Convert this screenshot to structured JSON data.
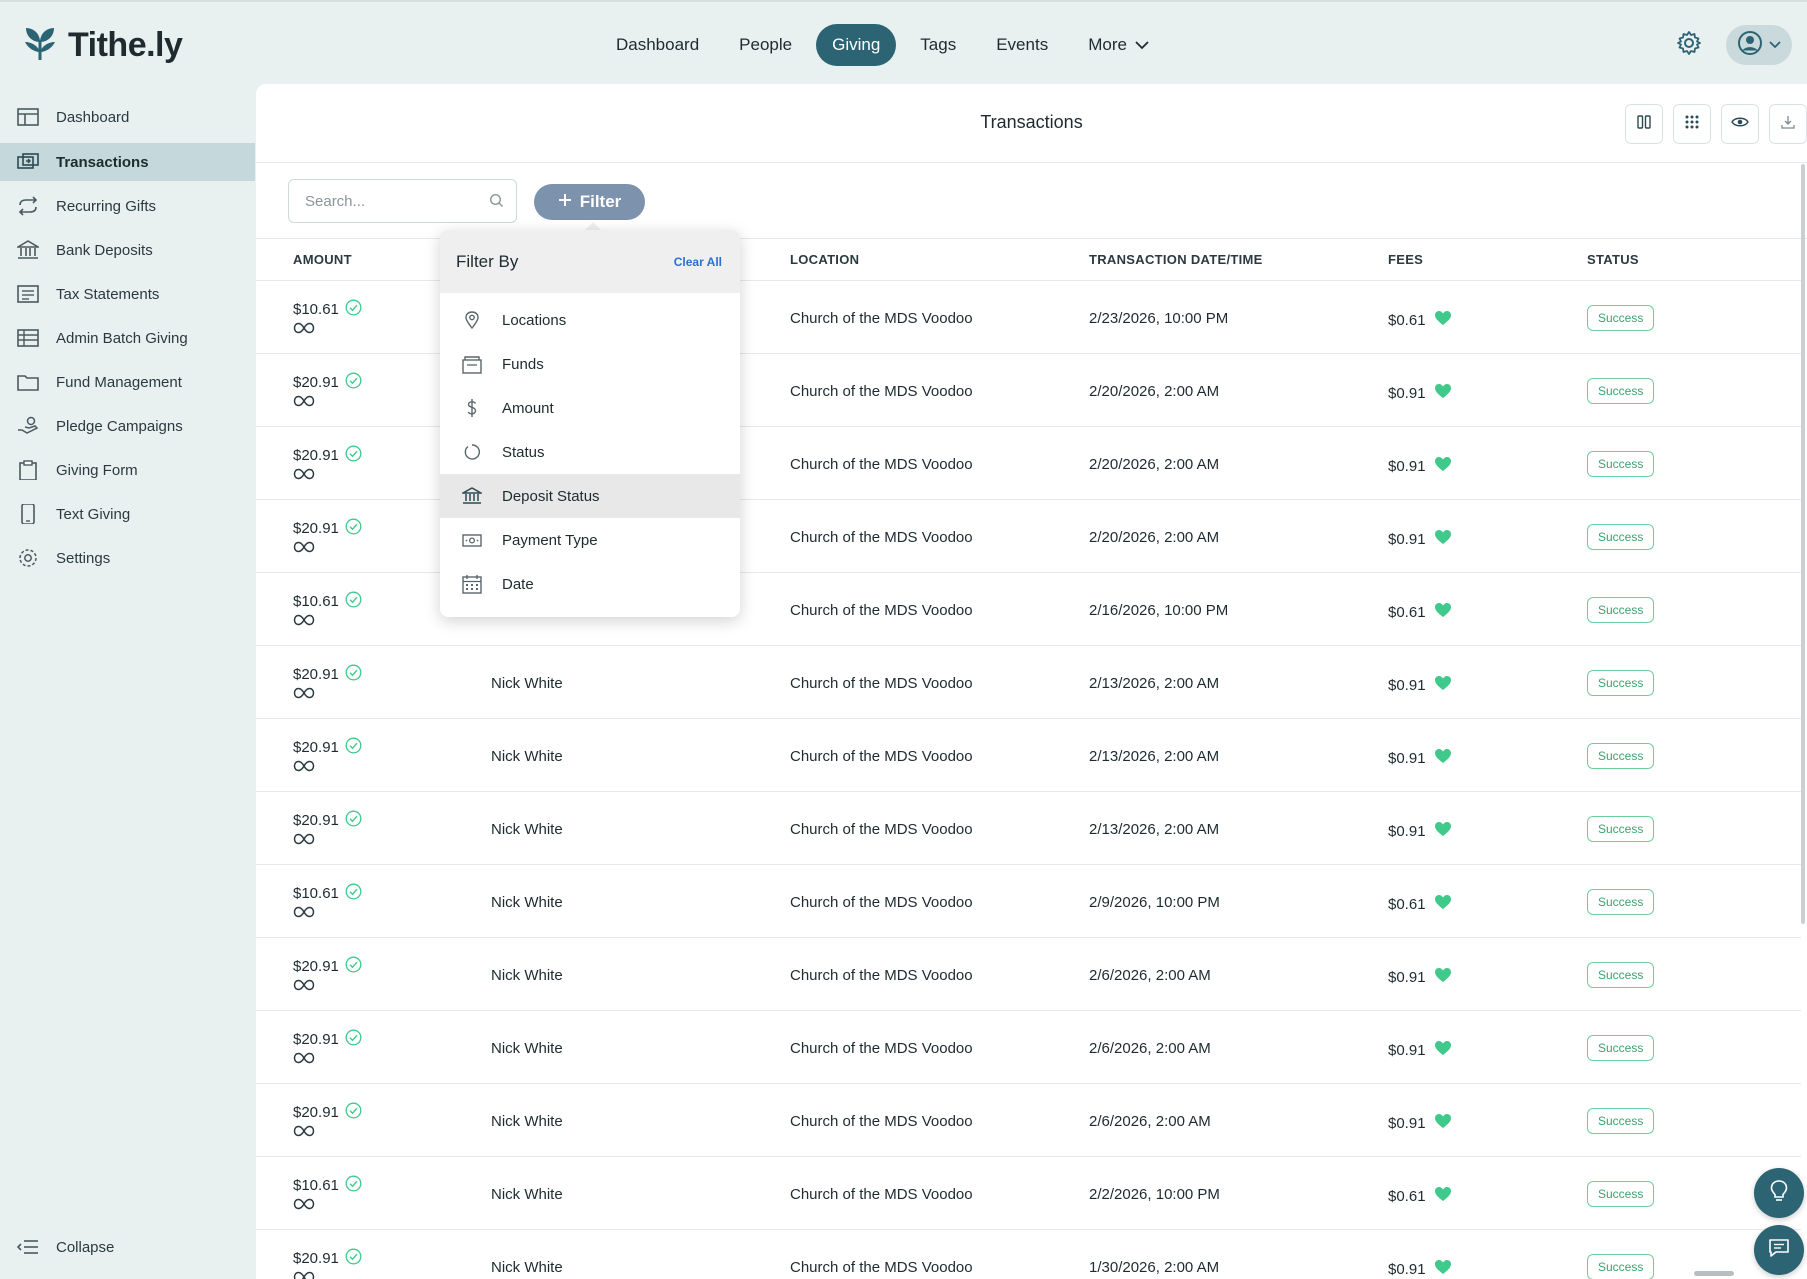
{
  "brand": {
    "name": "Tithe.ly",
    "accent": "#2c6474",
    "success": "#3ba36d",
    "heart": "#3fc98a"
  },
  "nav": {
    "items": [
      {
        "label": "Dashboard",
        "active": false
      },
      {
        "label": "People",
        "active": false
      },
      {
        "label": "Giving",
        "active": true
      },
      {
        "label": "Tags",
        "active": false
      },
      {
        "label": "Events",
        "active": false
      },
      {
        "label": "More",
        "active": false
      }
    ]
  },
  "sidebar": {
    "items": [
      {
        "label": "Dashboard",
        "icon": "dashboard-icon"
      },
      {
        "label": "Transactions",
        "icon": "transactions-icon",
        "active": true
      },
      {
        "label": "Recurring Gifts",
        "icon": "recurring-icon"
      },
      {
        "label": "Bank Deposits",
        "icon": "bank-icon"
      },
      {
        "label": "Tax Statements",
        "icon": "statement-icon"
      },
      {
        "label": "Admin Batch Giving",
        "icon": "batch-icon"
      },
      {
        "label": "Fund Management",
        "icon": "folder-icon"
      },
      {
        "label": "Pledge Campaigns",
        "icon": "pledge-icon"
      },
      {
        "label": "Giving Form",
        "icon": "clipboard-icon"
      },
      {
        "label": "Text Giving",
        "icon": "phone-icon"
      },
      {
        "label": "Settings",
        "icon": "gear-icon"
      }
    ],
    "collapse_label": "Collapse"
  },
  "main": {
    "title": "Transactions",
    "search": {
      "placeholder": "Search...",
      "value": ""
    },
    "filter_label": "Filter"
  },
  "table": {
    "columns": [
      "AMOUNT",
      "LOCATION",
      "TRANSACTION DATE/TIME",
      "FEES",
      "STATUS"
    ],
    "rows": [
      {
        "amount": "$10.61",
        "donor": "",
        "location": "Church of the MDS Voodoo",
        "date": "2/23/2026, 10:00 PM",
        "fee": "$0.61",
        "status": "Success"
      },
      {
        "amount": "$20.91",
        "donor": "",
        "location": "Church of the MDS Voodoo",
        "date": "2/20/2026, 2:00 AM",
        "fee": "$0.91",
        "status": "Success"
      },
      {
        "amount": "$20.91",
        "donor": "",
        "location": "Church of the MDS Voodoo",
        "date": "2/20/2026, 2:00 AM",
        "fee": "$0.91",
        "status": "Success"
      },
      {
        "amount": "$20.91",
        "donor": "",
        "location": "Church of the MDS Voodoo",
        "date": "2/20/2026, 2:00 AM",
        "fee": "$0.91",
        "status": "Success"
      },
      {
        "amount": "$10.61",
        "donor": "",
        "location": "Church of the MDS Voodoo",
        "date": "2/16/2026, 10:00 PM",
        "fee": "$0.61",
        "status": "Success"
      },
      {
        "amount": "$20.91",
        "donor": "Nick White",
        "location": "Church of the MDS Voodoo",
        "date": "2/13/2026, 2:00 AM",
        "fee": "$0.91",
        "status": "Success"
      },
      {
        "amount": "$20.91",
        "donor": "Nick White",
        "location": "Church of the MDS Voodoo",
        "date": "2/13/2026, 2:00 AM",
        "fee": "$0.91",
        "status": "Success"
      },
      {
        "amount": "$20.91",
        "donor": "Nick White",
        "location": "Church of the MDS Voodoo",
        "date": "2/13/2026, 2:00 AM",
        "fee": "$0.91",
        "status": "Success"
      },
      {
        "amount": "$10.61",
        "donor": "Nick White",
        "location": "Church of the MDS Voodoo",
        "date": "2/9/2026, 10:00 PM",
        "fee": "$0.61",
        "status": "Success"
      },
      {
        "amount": "$20.91",
        "donor": "Nick White",
        "location": "Church of the MDS Voodoo",
        "date": "2/6/2026, 2:00 AM",
        "fee": "$0.91",
        "status": "Success"
      },
      {
        "amount": "$20.91",
        "donor": "Nick White",
        "location": "Church of the MDS Voodoo",
        "date": "2/6/2026, 2:00 AM",
        "fee": "$0.91",
        "status": "Success"
      },
      {
        "amount": "$20.91",
        "donor": "Nick White",
        "location": "Church of the MDS Voodoo",
        "date": "2/6/2026, 2:00 AM",
        "fee": "$0.91",
        "status": "Success"
      },
      {
        "amount": "$10.61",
        "donor": "Nick White",
        "location": "Church of the MDS Voodoo",
        "date": "2/2/2026, 10:00 PM",
        "fee": "$0.61",
        "status": "Success"
      },
      {
        "amount": "$20.91",
        "donor": "Nick White",
        "location": "Church of the MDS Voodoo",
        "date": "1/30/2026, 2:00 AM",
        "fee": "$0.91",
        "status": "Success"
      }
    ]
  },
  "filter_menu": {
    "title": "Filter By",
    "clear_label": "Clear All",
    "items": [
      {
        "label": "Locations",
        "icon": "location-pin-icon"
      },
      {
        "label": "Funds",
        "icon": "funds-icon"
      },
      {
        "label": "Amount",
        "icon": "dollar-icon"
      },
      {
        "label": "Status",
        "icon": "status-icon"
      },
      {
        "label": "Deposit Status",
        "icon": "bank-icon",
        "highlighted": true
      },
      {
        "label": "Payment Type",
        "icon": "payment-icon"
      },
      {
        "label": "Date",
        "icon": "calendar-icon"
      }
    ]
  }
}
